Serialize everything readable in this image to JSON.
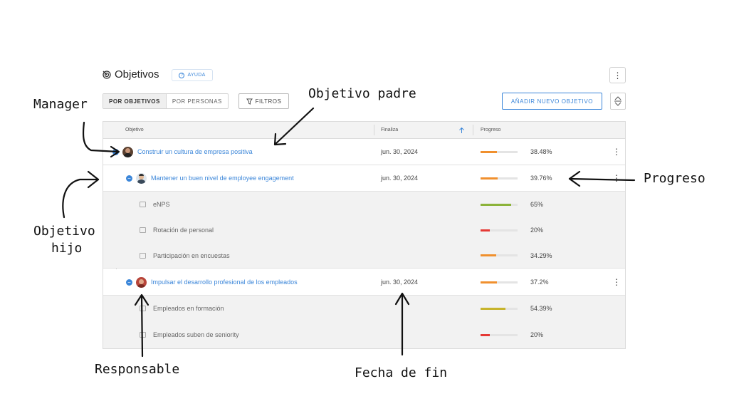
{
  "header": {
    "title": "Objetivos",
    "help_label": "AYUDA",
    "more_icon": "more-vertical-icon"
  },
  "toolbar": {
    "tab_objectives": "POR OBJETIVOS",
    "tab_people": "POR PERSONAS",
    "filters_label": "FILTROS",
    "add_label": "AÑADIR NUEVO OBJETIVO"
  },
  "table": {
    "col_objective": "Objetivo",
    "col_end": "Finaliza",
    "col_progress": "Progreso",
    "rows": [
      {
        "name": "Construir un cultura de empresa positiva",
        "date": "jun. 30, 2024",
        "progress": "38.48%",
        "fill": 0.45,
        "color": "#f0902e"
      },
      {
        "name": "Mantener un buen nivel de employee engagement",
        "date": "jun. 30, 2024",
        "progress": "39.76%",
        "fill": 0.46,
        "color": "#f0902e"
      },
      {
        "name": "eNPS",
        "progress": "65%",
        "fill": 0.82,
        "color": "#8cb33a"
      },
      {
        "name": "Rotación de personal",
        "progress": "20%",
        "fill": 0.25,
        "color": "#e53935"
      },
      {
        "name": "Participación en encuestas",
        "progress": "34.29%",
        "fill": 0.42,
        "color": "#f0902e"
      },
      {
        "name": "Impulsar el desarrollo profesional de los empleados",
        "date": "jun. 30, 2024",
        "progress": "37.2%",
        "fill": 0.45,
        "color": "#f0902e"
      },
      {
        "name": "Empleados en formación",
        "progress": "54.39%",
        "fill": 0.68,
        "color": "#c7b42c"
      },
      {
        "name": "Empleados suben de seniority",
        "progress": "20%",
        "fill": 0.25,
        "color": "#e53935"
      }
    ]
  },
  "annotations": {
    "manager": "Manager",
    "parent": "Objetivo padre",
    "child_line1": "Objetivo",
    "child_line2": "hijo",
    "progress": "Progreso",
    "owner": "Responsable",
    "end_date": "Fecha de fin"
  }
}
